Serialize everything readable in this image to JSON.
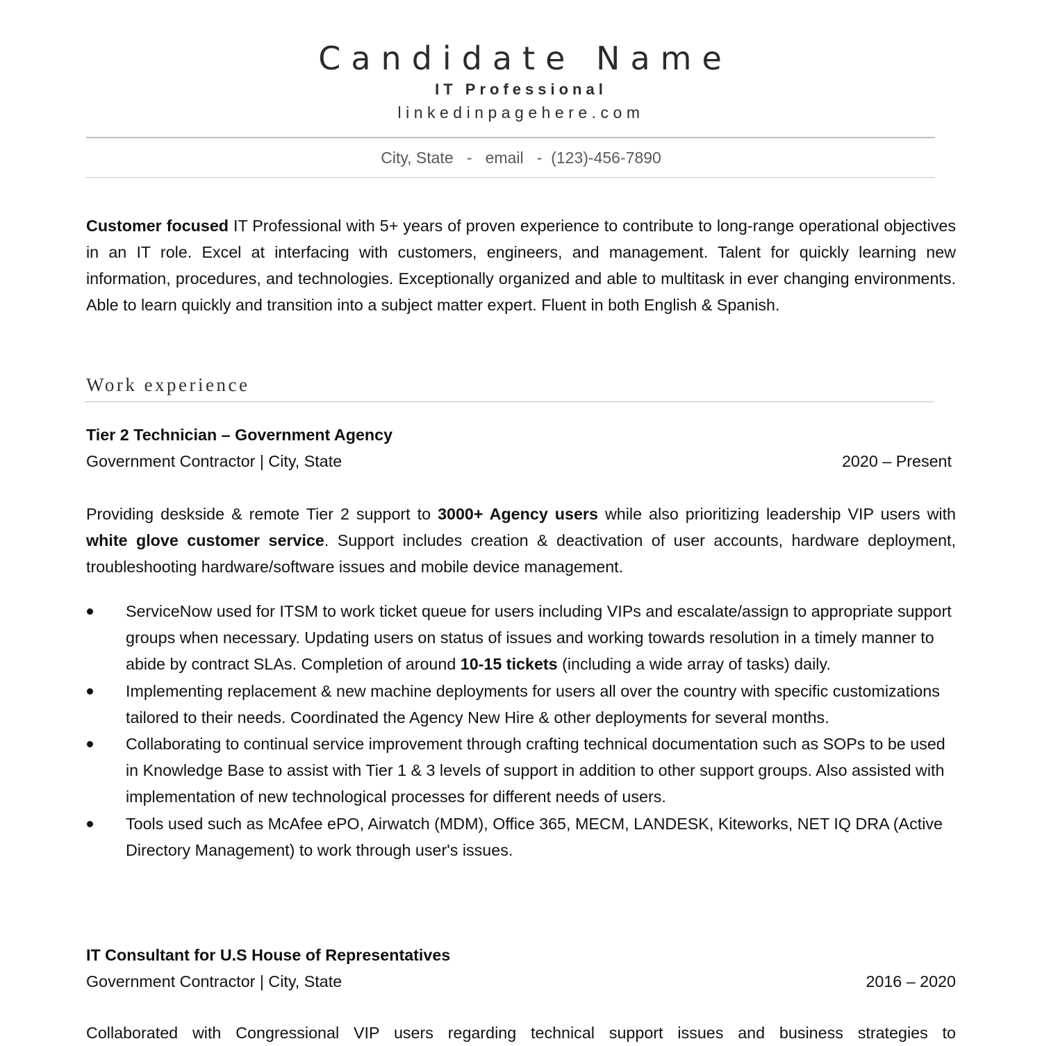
{
  "header": {
    "name": "Candidate Name",
    "title": "IT Professional",
    "link": "linkedinpagehere.com",
    "contact": {
      "city": "City, State",
      "separator": "-",
      "email": "email",
      "phone": "(123)-456-7890"
    }
  },
  "summary": {
    "lead_bold": "Customer focused",
    "text": " IT Professional with 5+ years of proven experience to contribute to long-range operational objectives in an IT role. Excel at interfacing with customers, engineers, and management. Talent for quickly learning new information, procedures, and technologies. Exceptionally organized and able to multitask in ever changing environments. Able to learn quickly and transition into a subject matter expert. Fluent in both English & Spanish."
  },
  "work_experience": {
    "heading": "Work experience",
    "jobs": [
      {
        "title": "Tier 2 Technician – Government Agency",
        "employer": "Government Contractor | City, State",
        "dates": "2020 – Present",
        "description": {
          "p1": "Providing deskside & remote Tier 2 support to ",
          "b1": "3000+ Agency users",
          "p2": " while also prioritizing leadership VIP users with ",
          "b2": "white glove customer service",
          "p3": ". Support includes creation & deactivation of user accounts, hardware deployment, troubleshooting hardware/software issues and mobile device management."
        },
        "bullets": [
          {
            "p1": "ServiceNow used for ITSM to work ticket queue for users including VIPs and escalate/assign to appropriate support groups when necessary. Updating users on status of issues and working towards resolution in a timely manner to abide by contract SLAs. Completion of around ",
            "b1": "10-15 tickets",
            "p2": " (including a wide array of tasks) daily."
          },
          {
            "text": "Implementing replacement & new machine deployments for users all over the country with specific customizations tailored to their needs. Coordinated the Agency New Hire & other deployments for several months."
          },
          {
            "text": "Collaborating to continual service improvement through crafting technical documentation such as SOPs to be used in Knowledge Base to assist with Tier 1 & 3 levels of support in addition to other support groups. Also assisted with implementation of new technological processes for different needs of users."
          },
          {
            "text": "Tools used such as McAfee ePO, Airwatch (MDM), Office 365, MECM, LANDESK, Kiteworks, NET IQ DRA (Active Directory Management) to work through user's issues."
          }
        ]
      },
      {
        "title": "IT Consultant for U.S House of Representatives",
        "employer": "Government Contractor | City, State",
        "dates": "2016 – 2020",
        "description_partial": "Collaborated with Congressional VIP users regarding technical support issues and business strategies to"
      }
    ]
  }
}
